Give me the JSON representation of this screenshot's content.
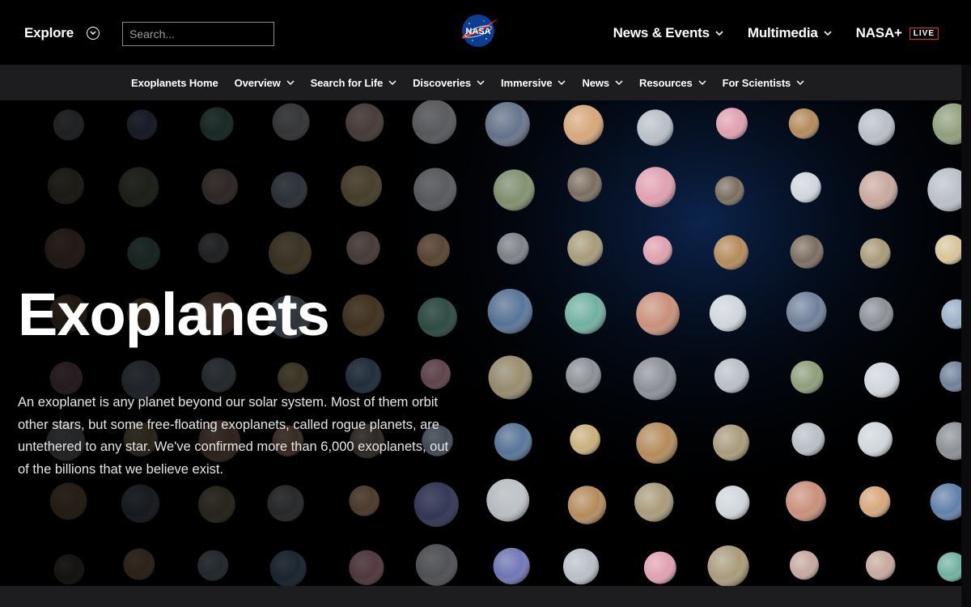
{
  "header": {
    "explore_label": "Explore",
    "search_placeholder": "Search...",
    "logo_text": "NASA",
    "nav": [
      {
        "label": "News & Events"
      },
      {
        "label": "Multimedia"
      },
      {
        "label": "NASA+",
        "badge": "LIVE"
      }
    ]
  },
  "subnav": [
    {
      "label": "Exoplanets Home",
      "dropdown": false
    },
    {
      "label": "Overview",
      "dropdown": true
    },
    {
      "label": "Search for Life",
      "dropdown": true
    },
    {
      "label": "Discoveries",
      "dropdown": true
    },
    {
      "label": "Immersive",
      "dropdown": true
    },
    {
      "label": "News",
      "dropdown": true
    },
    {
      "label": "Resources",
      "dropdown": true
    },
    {
      "label": "For Scientists",
      "dropdown": true
    }
  ],
  "hero": {
    "title": "Exoplanets",
    "description": "An exoplanet is any planet beyond our solar system. Most of them orbit other stars, but some free-floating exoplanets, called rogue planets, are untethered to any star. We've confirmed more than 6,000 exoplanets, out of the billions that we believe exist."
  },
  "colors": {
    "background": "#000000",
    "subnav_bg": "#1d1d1f",
    "live_badge": "#e0323a",
    "nasa_blue": "#0b3d91",
    "nasa_red": "#fc3d21"
  }
}
